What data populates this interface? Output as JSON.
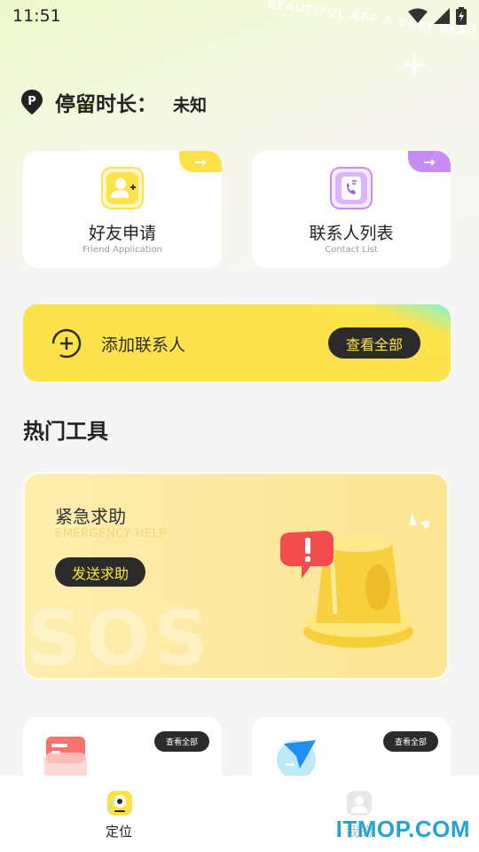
{
  "status_bar": {
    "time": "11:51"
  },
  "background": {
    "decor_text": "BEAUTIFUL APP A VERY BEAU"
  },
  "duration": {
    "label": "停留时长：",
    "value": "未知"
  },
  "cards": {
    "friend": {
      "title": "好友申请",
      "subtitle": "Friend Application",
      "corner": "→"
    },
    "contacts": {
      "title": "联系人列表",
      "subtitle": "Contact List",
      "corner": "→"
    }
  },
  "add_contact": {
    "label": "添加联系人",
    "button": "查看全部"
  },
  "section": {
    "title": "热门工具"
  },
  "emergency": {
    "title": "紧急求助",
    "subtitle": "EMERGENCY HELP",
    "button": "发送求助",
    "bg_text": "SOS"
  },
  "tools": {
    "left_button": "查看全部",
    "right_button": "查看全部"
  },
  "nav": {
    "items": [
      {
        "label": "定位"
      },
      {
        "label": "我的"
      }
    ]
  },
  "watermark": "ITMOP.COM",
  "colors": {
    "accent_yellow": "#fde24c",
    "dark_button": "#2b2b2b",
    "purple": "#c78df4"
  }
}
